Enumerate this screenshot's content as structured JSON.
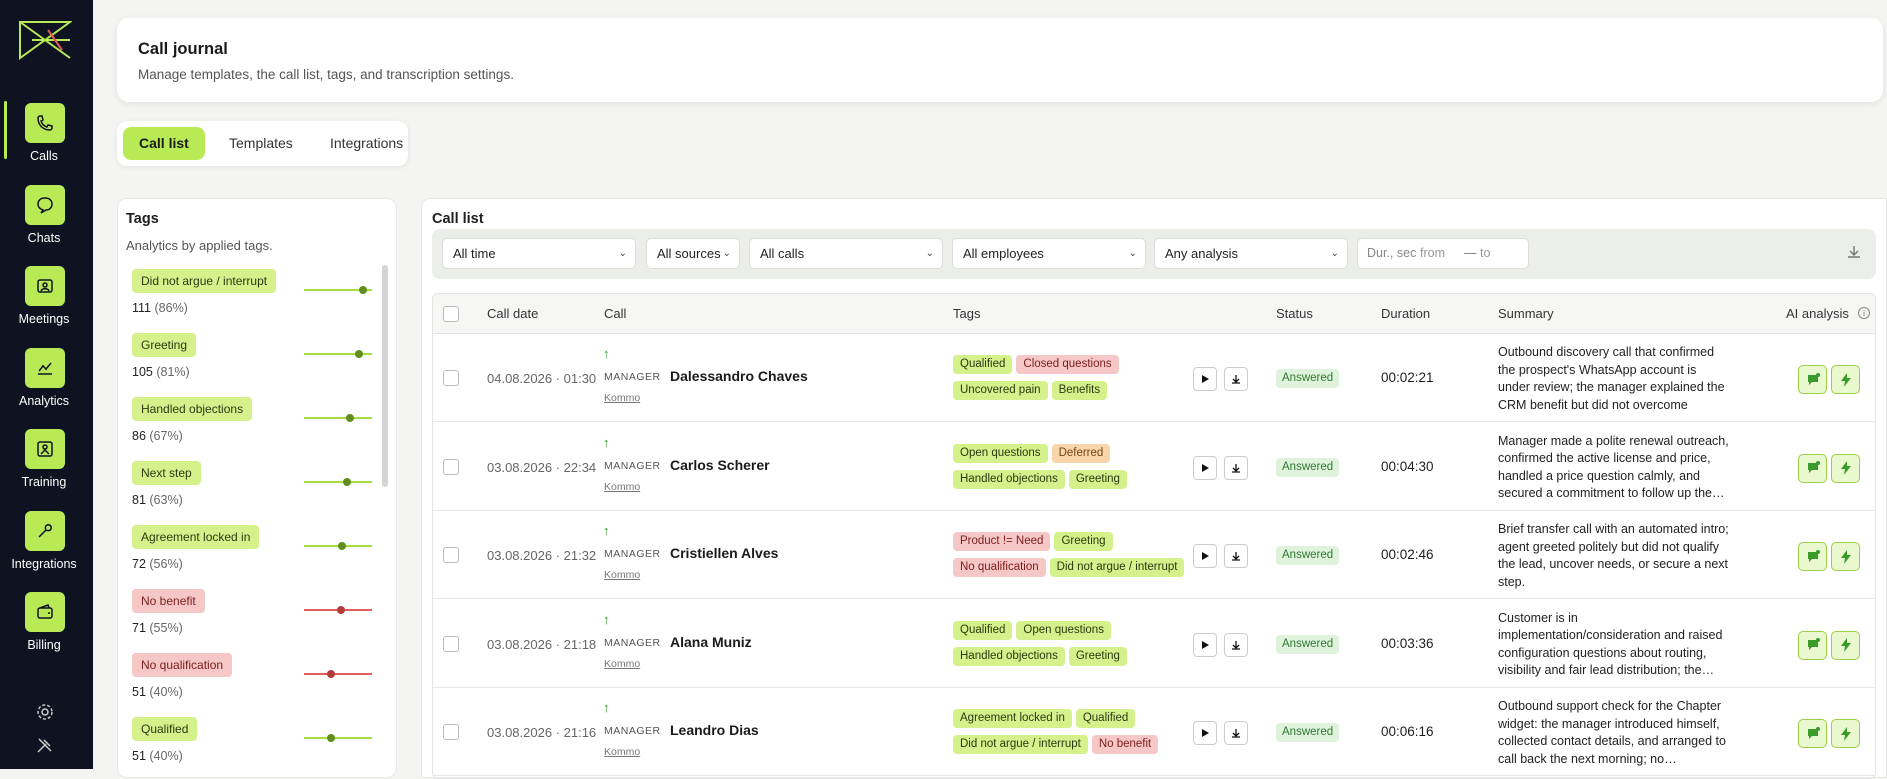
{
  "sidebar": {
    "items": [
      {
        "label": "Calls",
        "icon": "phone-icon",
        "active": true
      },
      {
        "label": "Chats",
        "icon": "chat-icon"
      },
      {
        "label": "Meetings",
        "icon": "meeting-icon"
      },
      {
        "label": "Analytics",
        "icon": "analytics-icon"
      },
      {
        "label": "Training",
        "icon": "training-icon"
      },
      {
        "label": "Integrations",
        "icon": "wrench-icon"
      },
      {
        "label": "Billing",
        "icon": "wallet-icon"
      }
    ],
    "accent": "#b8ea55",
    "background": "#0f1221"
  },
  "header": {
    "title": "Call journal",
    "subtitle": "Manage templates, the call list, tags, and transcription settings."
  },
  "tabs": [
    {
      "label": "Call list",
      "active": true
    },
    {
      "label": "Templates"
    },
    {
      "label": "Integrations"
    }
  ],
  "tags_panel": {
    "title": "Tags",
    "subtitle": "Analytics by applied tags.",
    "items": [
      {
        "label": "Did not argue / interrupt",
        "count": "111",
        "pct": "(86%)",
        "tone": "green",
        "level": 0.86
      },
      {
        "label": "Greeting",
        "count": "105",
        "pct": "(81%)",
        "tone": "green",
        "level": 0.81
      },
      {
        "label": "Handled objections",
        "count": "86",
        "pct": "(67%)",
        "tone": "green",
        "level": 0.67
      },
      {
        "label": "Next step",
        "count": "81",
        "pct": "(63%)",
        "tone": "green",
        "level": 0.63
      },
      {
        "label": "Agreement locked in",
        "count": "72",
        "pct": "(56%)",
        "tone": "green",
        "level": 0.56
      },
      {
        "label": "No benefit",
        "count": "71",
        "pct": "(55%)",
        "tone": "red",
        "level": 0.55
      },
      {
        "label": "No qualification",
        "count": "51",
        "pct": "(40%)",
        "tone": "red",
        "level": 0.4
      },
      {
        "label": "Qualified",
        "count": "51",
        "pct": "(40%)",
        "tone": "green",
        "level": 0.4
      }
    ]
  },
  "calls": {
    "title": "Call list",
    "filters": {
      "time": "All time",
      "sources": "All sources",
      "calls": "All calls",
      "employees": "All employees",
      "analysis": "Any analysis",
      "duration_label": "Dur., sec",
      "from_placeholder": "from",
      "to_placeholder": "to",
      "dash": "—"
    },
    "columns": {
      "date": "Call date",
      "call": "Call",
      "tags": "Tags",
      "status": "Status",
      "duration": "Duration",
      "summary": "Summary",
      "ai": "AI analysis"
    },
    "rows": [
      {
        "date": "04.08.2026 · 01:30",
        "role": "MANAGER",
        "name": "Dalessandro Chaves",
        "source": "Kommo",
        "tags": [
          {
            "label": "Qualified",
            "tone": "green"
          },
          {
            "label": "Closed questions",
            "tone": "red"
          },
          {
            "label": "Uncovered pain",
            "tone": "green"
          },
          {
            "label": "Benefits",
            "tone": "green"
          }
        ],
        "status": "Answered",
        "duration": "00:02:21",
        "summary": "Outbound discovery call that confirmed the prospect's WhatsApp account is under review; the manager explained the CRM benefit but did not overcome price…"
      },
      {
        "date": "03.08.2026 · 22:34",
        "role": "MANAGER",
        "name": "Carlos Scherer",
        "source": "Kommo",
        "tags": [
          {
            "label": "Open questions",
            "tone": "green"
          },
          {
            "label": "Deferred",
            "tone": "orange"
          },
          {
            "label": "Handled objections",
            "tone": "green"
          },
          {
            "label": "Greeting",
            "tone": "green"
          }
        ],
        "status": "Answered",
        "duration": "00:04:30",
        "summary": "Manager made a polite renewal outreach, confirmed the active license and price, handled a price question calmly, and secured a commitment to follow up the…"
      },
      {
        "date": "03.08.2026 · 21:32",
        "role": "MANAGER",
        "name": "Cristiellen Alves",
        "source": "Kommo",
        "tags": [
          {
            "label": "Product != Need",
            "tone": "red"
          },
          {
            "label": "Greeting",
            "tone": "green"
          },
          {
            "label": "No qualification",
            "tone": "red"
          },
          {
            "label": "Did not argue / interrupt",
            "tone": "green"
          }
        ],
        "status": "Answered",
        "duration": "00:02:46",
        "summary": "Brief transfer call with an automated intro; agent greeted politely but did not qualify the lead, uncover needs, or secure a next step."
      },
      {
        "date": "03.08.2026 · 21:18",
        "role": "MANAGER",
        "name": "Alana Muniz",
        "source": "Kommo",
        "tags": [
          {
            "label": "Qualified",
            "tone": "green"
          },
          {
            "label": "Open questions",
            "tone": "green"
          },
          {
            "label": "Handled objections",
            "tone": "green"
          },
          {
            "label": "Greeting",
            "tone": "green"
          }
        ],
        "status": "Answered",
        "duration": "00:03:36",
        "summary": "Customer is in implementation/consideration and raised configuration questions about routing, visibility and fair lead distribution; the…"
      },
      {
        "date": "03.08.2026 · 21:16",
        "role": "MANAGER",
        "name": "Leandro Dias",
        "source": "Kommo",
        "tags": [
          {
            "label": "Agreement locked in",
            "tone": "green"
          },
          {
            "label": "Qualified",
            "tone": "green"
          },
          {
            "label": "Did not argue / interrupt",
            "tone": "green"
          },
          {
            "label": "No benefit",
            "tone": "red"
          }
        ],
        "status": "Answered",
        "duration": "00:06:16",
        "summary": "Outbound support check for the Chapter widget: the manager introduced himself, collected contact details, and arranged to call back the next morning; no…"
      }
    ]
  }
}
